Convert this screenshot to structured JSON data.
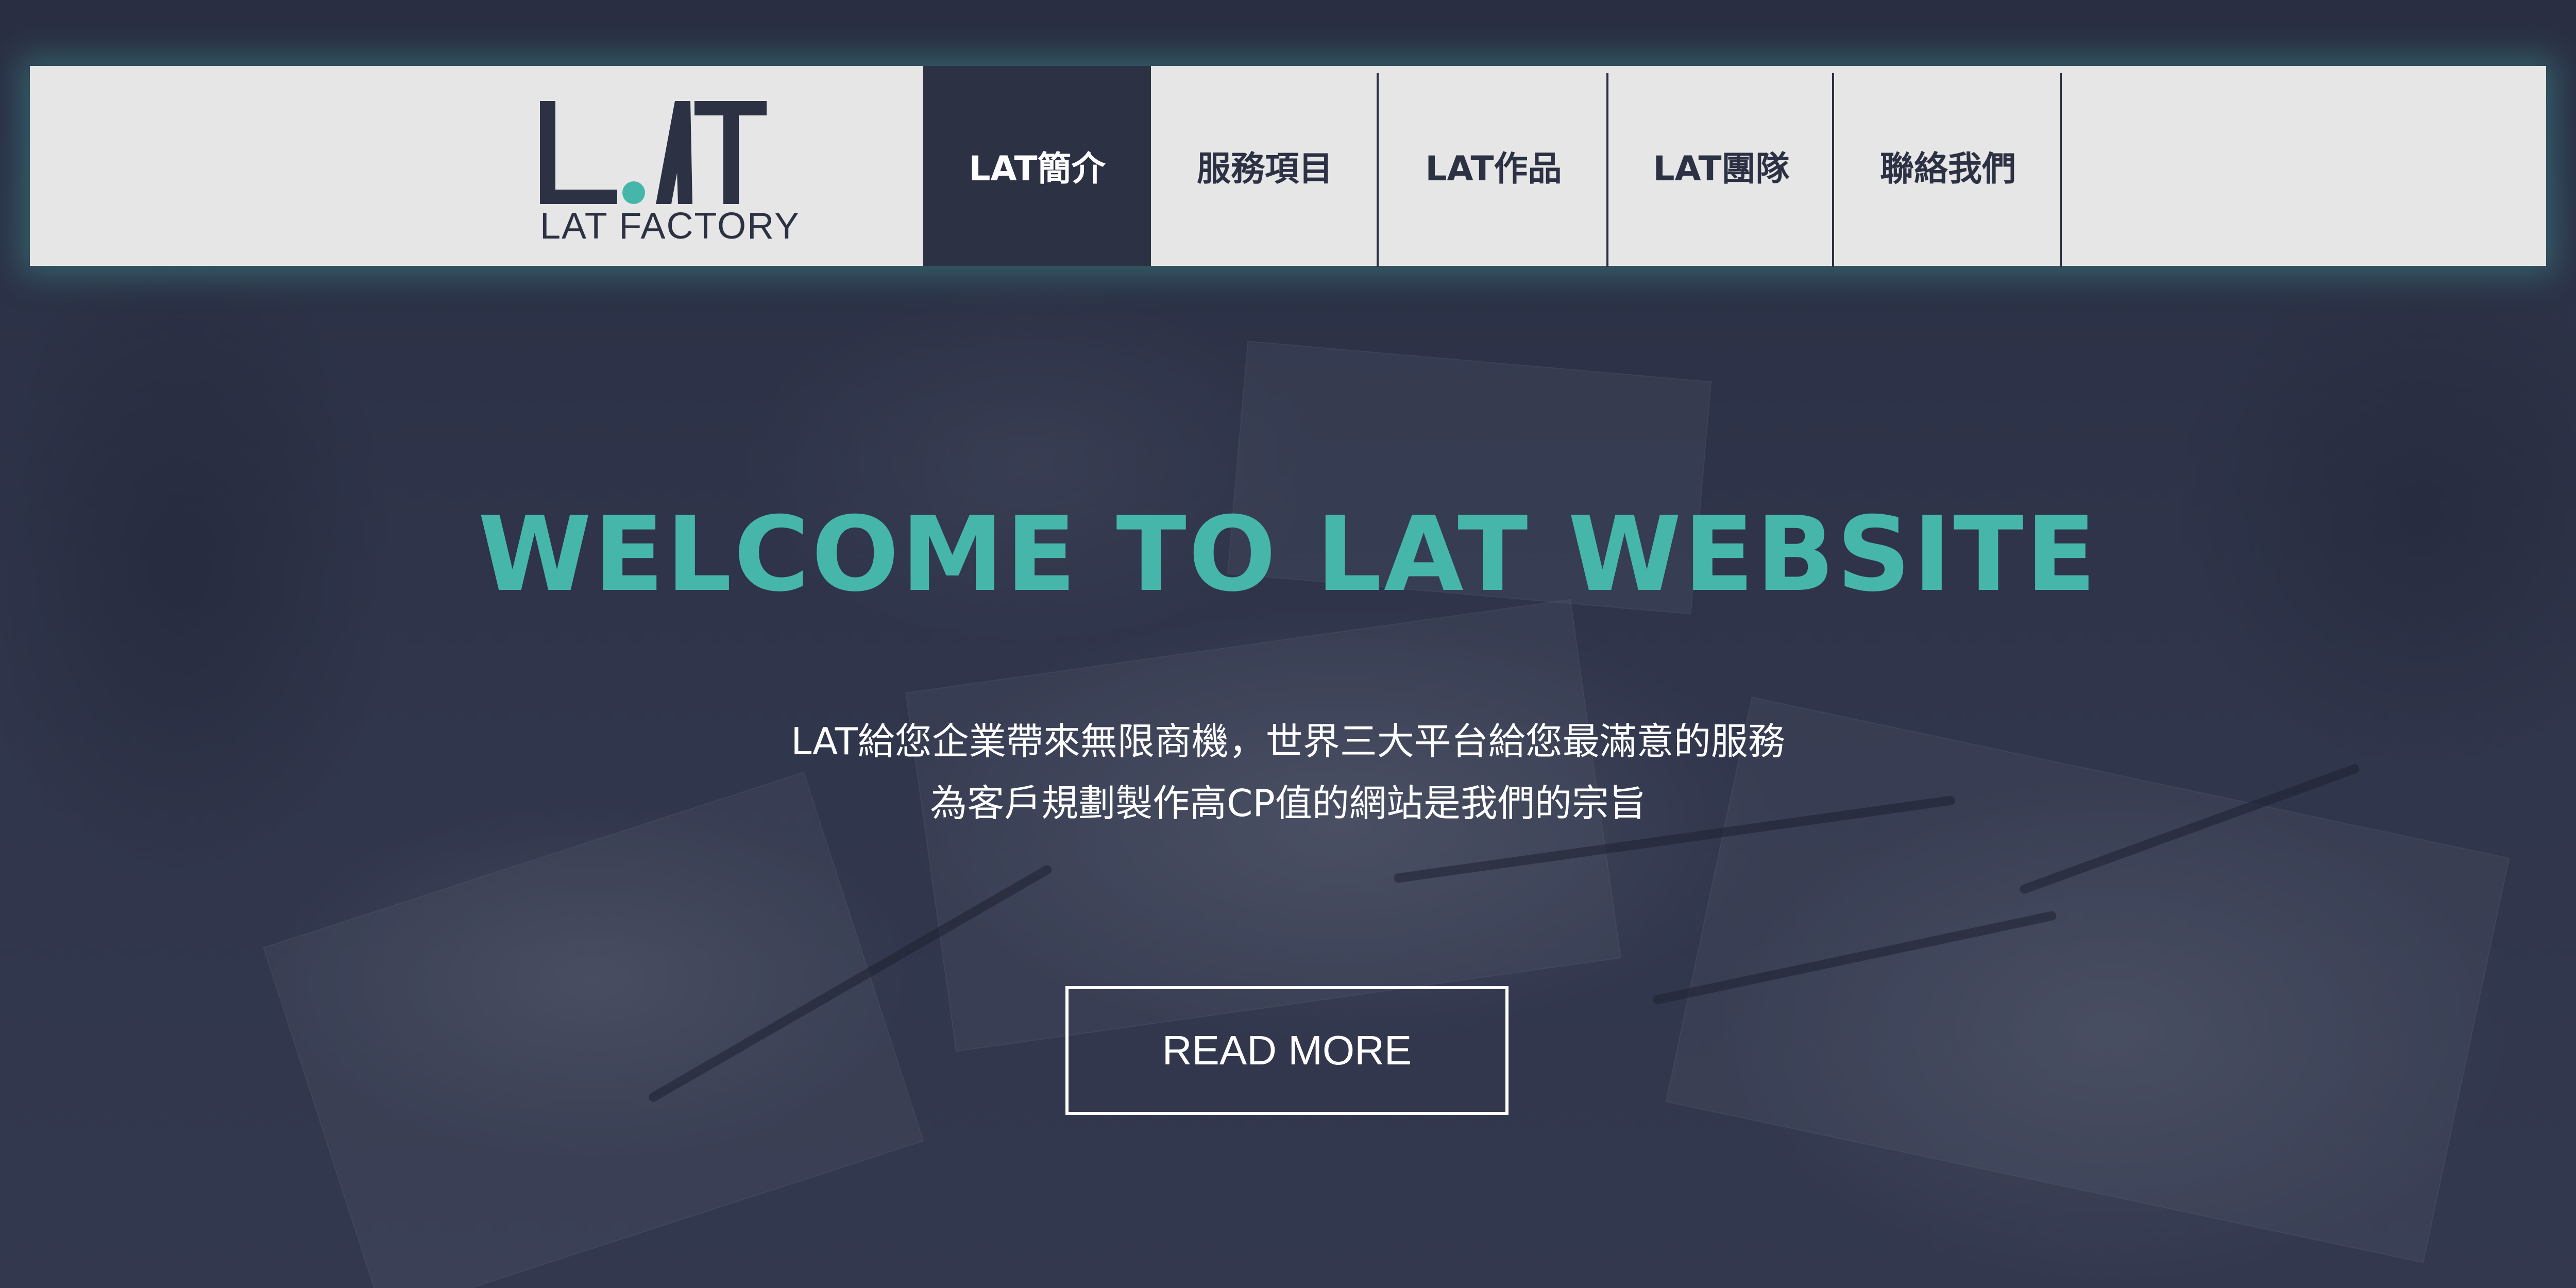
{
  "logo": {
    "mark": "LAT",
    "text": "LAT FACTORY",
    "colors": {
      "dark": "#2d3144",
      "accent": "#46b6ab"
    }
  },
  "nav": {
    "items": [
      {
        "label": "LAT簡介",
        "active": true
      },
      {
        "label": "服務項目",
        "active": false
      },
      {
        "label": "LAT作品",
        "active": false
      },
      {
        "label": "LAT團隊",
        "active": false
      },
      {
        "label": "聯絡我們",
        "active": false
      }
    ]
  },
  "hero": {
    "title": "WELCOME TO LAT WEBSITE",
    "subtitle_lines": [
      "LAT給您企業帶來無限商機，世界三大平台給您最滿意的服務",
      "為客戶規劃製作高CP值的網站是我們的宗旨"
    ],
    "cta_label": "READ MORE"
  },
  "colors": {
    "header_bg": "#e6e6e6",
    "nav_active_bg": "#2d3144",
    "title": "#46b6ab",
    "overlay": "#2e3347"
  }
}
